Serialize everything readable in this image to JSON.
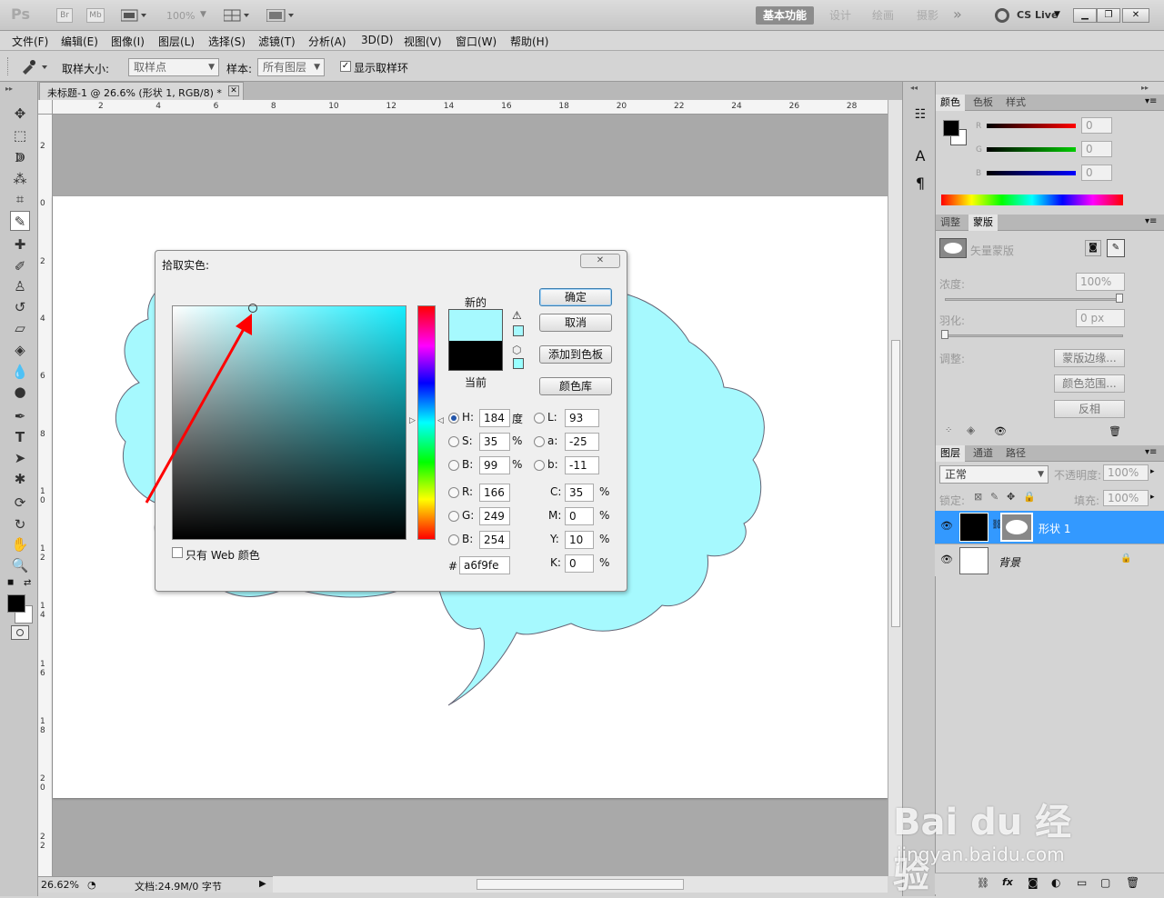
{
  "app": {
    "logo": "Ps",
    "bridge": "Br",
    "minibridge": "Mb",
    "zoom": "100%",
    "workspaces": [
      "基本功能",
      "设计",
      "绘画",
      "摄影"
    ],
    "more": "»",
    "cslive": "CS Live"
  },
  "menu": [
    "文件(F)",
    "编辑(E)",
    "图像(I)",
    "图层(L)",
    "选择(S)",
    "滤镜(T)",
    "分析(A)",
    "3D(D)",
    "视图(V)",
    "窗口(W)",
    "帮助(H)"
  ],
  "options": {
    "sample_size_label": "取样大小:",
    "sample_size_value": "取样点",
    "sample_label": "样本:",
    "sample_value": "所有图层",
    "show_ring": "显示取样环"
  },
  "document": {
    "tab_title": "未标题-1 @ 26.6% (形状 1, RGB/8) *",
    "ruler_h": [
      "2",
      "4",
      "6",
      "8",
      "10",
      "12",
      "14",
      "16",
      "18",
      "20",
      "22",
      "24",
      "26",
      "28"
    ],
    "ruler_v": [
      "2",
      "0",
      "2",
      "4",
      "6",
      "8",
      "1 0",
      "1 2",
      "1 4",
      "1 6",
      "1 8",
      "2 0",
      "2 2"
    ],
    "status_zoom": "26.62%",
    "status_doc": "文档:24.9M/0 字节"
  },
  "dialog": {
    "title": "拾取实色:",
    "new_label": "新的",
    "current_label": "当前",
    "ok": "确定",
    "cancel": "取消",
    "add_swatch": "添加到色板",
    "libraries": "颜色库",
    "web_only": "只有 Web 颜色",
    "hsb": [
      {
        "label": "H:",
        "value": "184",
        "unit": "度"
      },
      {
        "label": "S:",
        "value": "35",
        "unit": "%"
      },
      {
        "label": "B:",
        "value": "99",
        "unit": "%"
      }
    ],
    "rgb": [
      {
        "label": "R:",
        "value": "166"
      },
      {
        "label": "G:",
        "value": "249"
      },
      {
        "label": "B:",
        "value": "254"
      }
    ],
    "lab": [
      {
        "label": "L:",
        "value": "93"
      },
      {
        "label": "a:",
        "value": "-25"
      },
      {
        "label": "b:",
        "value": "-11"
      }
    ],
    "cmyk": [
      {
        "label": "C:",
        "value": "35",
        "unit": "%"
      },
      {
        "label": "M:",
        "value": "0",
        "unit": "%"
      },
      {
        "label": "Y:",
        "value": "10",
        "unit": "%"
      },
      {
        "label": "K:",
        "value": "0",
        "unit": "%"
      }
    ],
    "hex_label": "#",
    "hex": "a6f9fe",
    "new_color": "#a6f9fe",
    "current_color": "#000000"
  },
  "panels": {
    "color_tabs": [
      "颜色",
      "色板",
      "样式"
    ],
    "rgb_labels": [
      "R",
      "G",
      "B"
    ],
    "rgb_values": [
      "0",
      "0",
      "0"
    ],
    "adjust_tabs": [
      "调整",
      "蒙版"
    ],
    "vector_mask": "矢量蒙版",
    "density_label": "浓度:",
    "density_value": "100%",
    "feather_label": "羽化:",
    "feather_value": "0 px",
    "refine_label": "调整:",
    "mask_edge": "蒙版边缘...",
    "color_range": "颜色范围...",
    "invert": "反相",
    "layer_tabs": [
      "图层",
      "通道",
      "路径"
    ],
    "blend_mode": "正常",
    "opacity_label": "不透明度:",
    "opacity_value": "100%",
    "lock_label": "锁定:",
    "fill_label": "填充:",
    "fill_value": "100%",
    "layers": [
      "形状 1",
      "背景"
    ]
  },
  "watermark": {
    "brand": "Bai du 经验",
    "url": "jingyan.baidu.com"
  },
  "colors": {
    "shape_fill": "#a6f9fe",
    "selection": "#3399ff"
  }
}
